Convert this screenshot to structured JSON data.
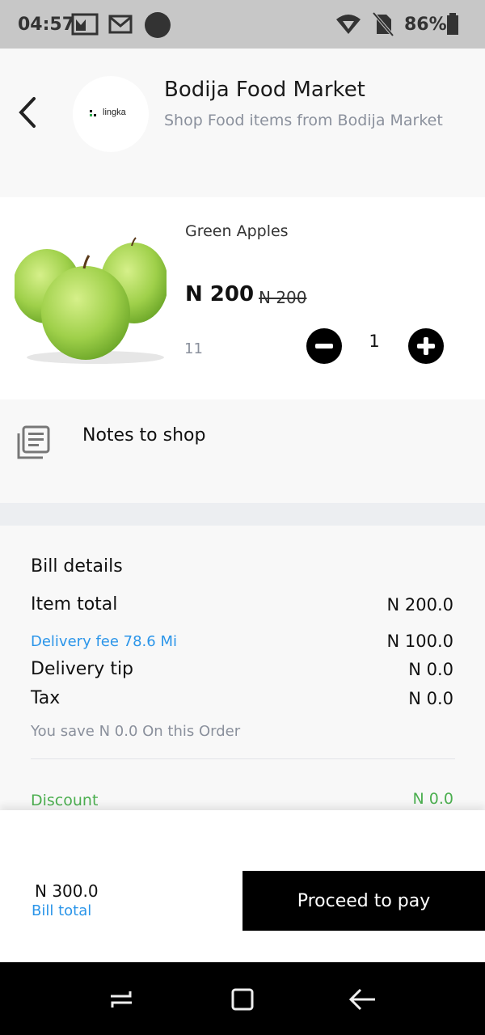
{
  "status": {
    "time": "04:57",
    "battery": "86%",
    "icons": [
      "gallery-icon",
      "gmail-icon",
      "circle-icon",
      "wifi-icon",
      "no-sim-icon",
      "battery-icon"
    ]
  },
  "header": {
    "title": "Bodija Food Market",
    "subtitle": "Shop Food items from Bodija Market",
    "logo_text": "lingka"
  },
  "product": {
    "name": "Green Apples",
    "price": "N 200",
    "old_price": "N 200",
    "stock": "11",
    "quantity": "1"
  },
  "notes": {
    "label": "Notes to shop"
  },
  "bill": {
    "heading": "Bill details",
    "rows": [
      {
        "label": "Item total",
        "value": "N 200.0"
      },
      {
        "label": "Delivery fee 78.6 Mi",
        "value": "N 100.0"
      },
      {
        "label": "Delivery tip",
        "value": "N 0.0"
      },
      {
        "label": "Tax",
        "value": "N 0.0"
      }
    ],
    "savings": "You save N 0.0  On this Order",
    "discount_label": "Discount",
    "discount_value": "N 0.0"
  },
  "footer": {
    "total_amount": "N 300.0",
    "total_label": "Bill total",
    "pay_label": "Proceed to pay"
  },
  "colors": {
    "accent_blue": "#2b95e9",
    "discount_green": "#4caf50",
    "muted_gray": "#8a909c"
  }
}
